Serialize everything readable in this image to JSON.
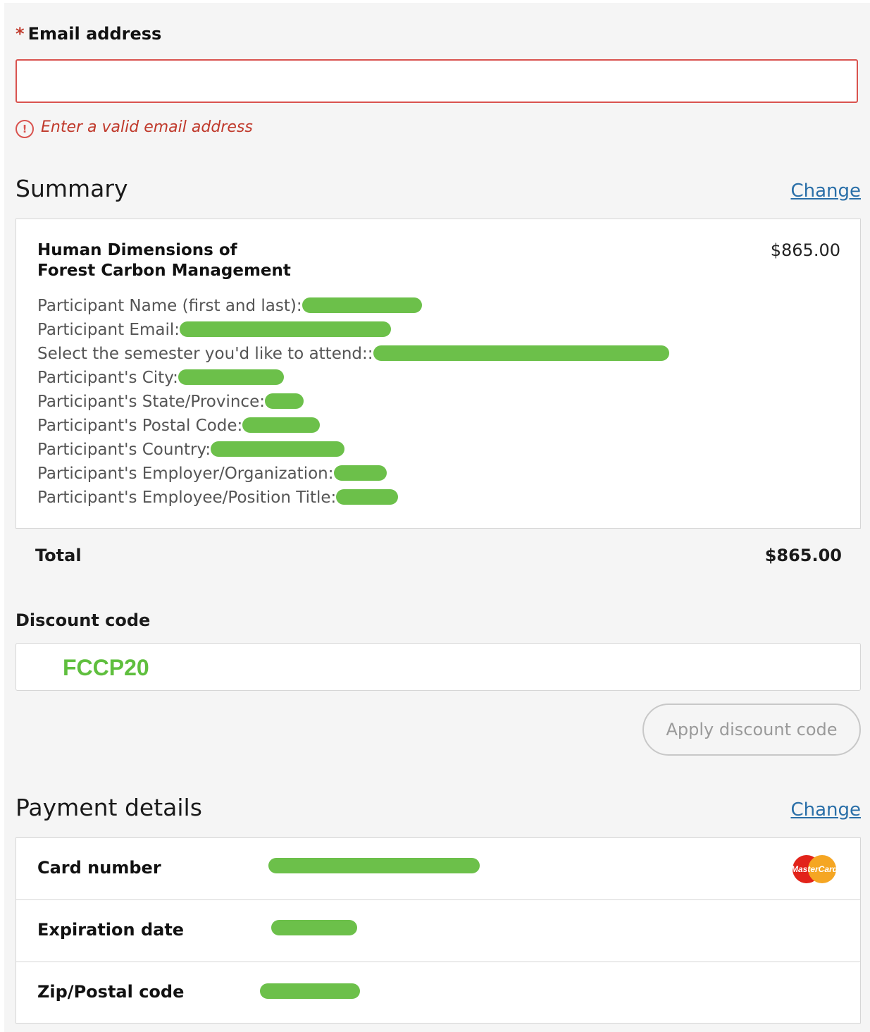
{
  "email": {
    "required_marker": "*",
    "label": "Email address",
    "value": "",
    "error_icon": "!",
    "error_message": "Enter a valid email address"
  },
  "summary": {
    "title": "Summary",
    "change_label": "Change",
    "product": {
      "title_line1": "Human Dimensions of",
      "title_line2": "Forest Carbon Management",
      "price": "$865.00"
    },
    "details": [
      "Participant Name (first and last):",
      "Participant Email:",
      "Select the semester you'd like to attend::",
      "Participant's City:",
      "Participant's State/Province:",
      "Participant's Postal Code:",
      "Participant's Country:",
      "Participant's Employer/Organization:",
      "Participant's Employee/Position Title:"
    ],
    "total_label": "Total",
    "total_value": "$865.00"
  },
  "discount": {
    "label": "Discount code",
    "value": "FCCP20",
    "apply_label": "Apply discount code"
  },
  "payment": {
    "title": "Payment details",
    "change_label": "Change",
    "rows": [
      {
        "label": "Card number"
      },
      {
        "label": "Expiration date"
      },
      {
        "label": "Zip/Postal code"
      }
    ],
    "card_brand": "MasterCard"
  },
  "colors": {
    "error": "#d9534f",
    "link": "#2a6fa8",
    "redaction": "#6cc04a",
    "discount_code": "#5fbf3e"
  }
}
